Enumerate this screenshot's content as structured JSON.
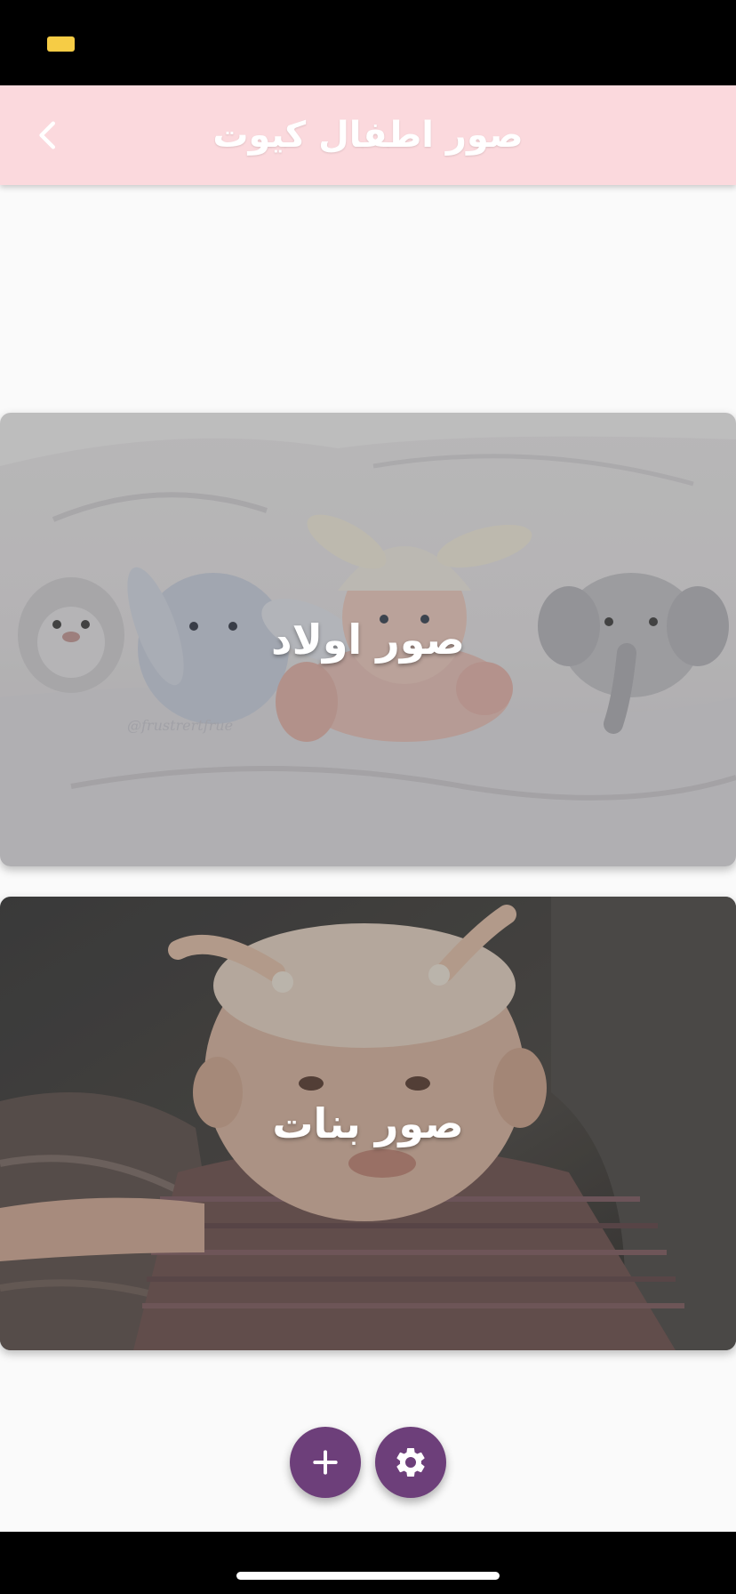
{
  "status_bar": {
    "battery_color": "#f6cc45"
  },
  "app_bar": {
    "title": "صور اطفال كيوت",
    "back_icon": "chevron-left-icon",
    "background": "#fbd9dd"
  },
  "categories": [
    {
      "label": "صور اولاد",
      "watermark": "@frustrertfrue"
    },
    {
      "label": "صور بنات"
    }
  ],
  "fabs": {
    "add_icon": "plus-icon",
    "settings_icon": "gear-icon",
    "color": "#6d3f7a"
  }
}
